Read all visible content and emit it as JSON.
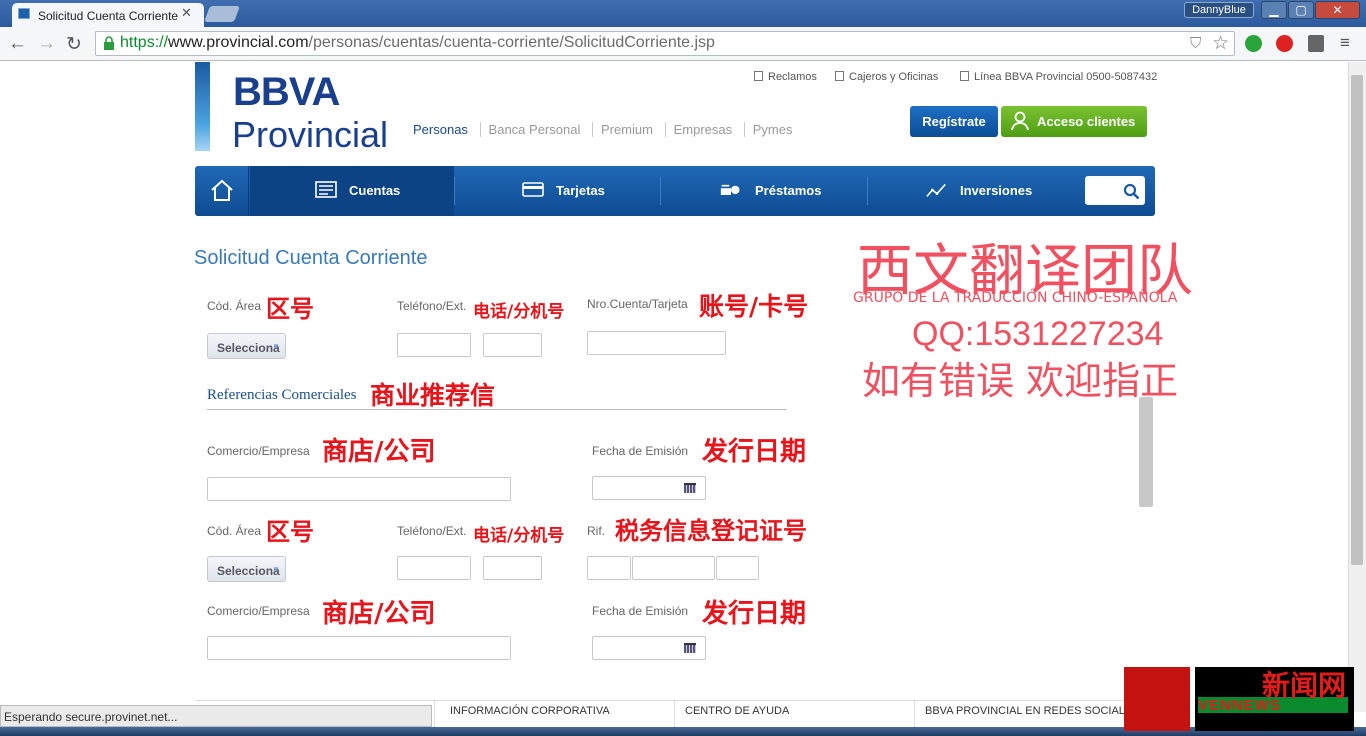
{
  "browser": {
    "tab_title": "Solicitud Cuenta Corriente",
    "user": "DannyBlue",
    "url_scheme": "https://",
    "url_host": "www.provincial.com",
    "url_path": "/personas/cuentas/cuenta-corriente/SolicitudCorriente.jsp",
    "status": "Esperando secure.provinet.net..."
  },
  "header": {
    "logo_top": "BBVA",
    "logo_bottom": "Provincial",
    "top_links": [
      "Reclamos",
      "Cajeros y Oficinas",
      "Línea BBVA Provincial 0500-5087432"
    ],
    "segments": [
      "Personas",
      "Banca Personal",
      "Premium",
      "Empresas",
      "Pymes"
    ],
    "register_label": "Regístrate",
    "login_label": "Acceso clientes"
  },
  "main_nav": {
    "items": [
      "Cuentas",
      "Tarjetas",
      "Préstamos",
      "Inversiones"
    ]
  },
  "form": {
    "title": "Solicitud Cuenta Corriente",
    "area_label": "Cód. Área",
    "phone_label": "Teléfono/Ext.",
    "account_label": "Nro.Cuenta/Tarjeta",
    "select_value": "Selecciona",
    "refs_title": "Referencias Comerciales",
    "company_label": "Comercio/Empresa",
    "date_label": "Fecha de Emisión",
    "rif_label": "Rif."
  },
  "annotations": {
    "area": "区号",
    "phone": "电话/分机号",
    "account": "账号/卡号",
    "refs": "商业推荐信",
    "company": "商店/公司",
    "date": "发行日期",
    "rif": "税务信息登记证号"
  },
  "watermark": {
    "title": "西文翻译团队",
    "subtitle": "GRUPO DE LA TRADUCCIÓN CHINO-ESPAÑOLA",
    "qq": "QQ:1531227234",
    "note": "如有错误  欢迎指正"
  },
  "footer": {
    "columns": [
      "INFORMACIÓN CORPORATIVA",
      "CENTRO DE AYUDA",
      "BBVA PROVINCIAL EN REDES SOCIALES"
    ]
  },
  "corner_logo": {
    "cn": "新闻网",
    "en": "VENNEWS"
  },
  "colors": {
    "brand_blue": "#1a3f8c",
    "nav_blue": "#0e4c92",
    "accent_green": "#4e9d14",
    "annotation_red": "#e8141b"
  }
}
